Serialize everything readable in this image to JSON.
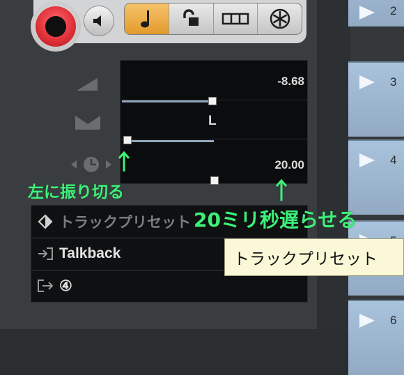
{
  "toolbar": {
    "record_icon": "record-icon",
    "monitor_icon": "speaker-icon",
    "tools": [
      {
        "name": "note-icon",
        "active": true
      },
      {
        "name": "unlock-icon",
        "active": false
      },
      {
        "name": "grid-icon",
        "active": false
      },
      {
        "name": "freeze-icon",
        "active": false
      }
    ],
    "accent_color": "#e8a23a",
    "record_color": "#e2323a"
  },
  "display": {
    "volume_value": "-8.68",
    "pan_value": "L",
    "delay_value": "20.00",
    "pan_level": 0.5
  },
  "rows": [
    {
      "icon": "preset-icon",
      "label": "トラックプリセット"
    },
    {
      "icon": "input-icon",
      "label": "Talkback"
    },
    {
      "icon": "output-icon",
      "label": "④"
    }
  ],
  "tracklist": {
    "numbers": [
      "2",
      "3",
      "4",
      "5",
      "6"
    ]
  },
  "annotations": {
    "pan_note": "左に振り切る",
    "delay_note": "20ミリ秒遅らせる"
  },
  "tooltip": {
    "text": "トラックプリセット"
  }
}
